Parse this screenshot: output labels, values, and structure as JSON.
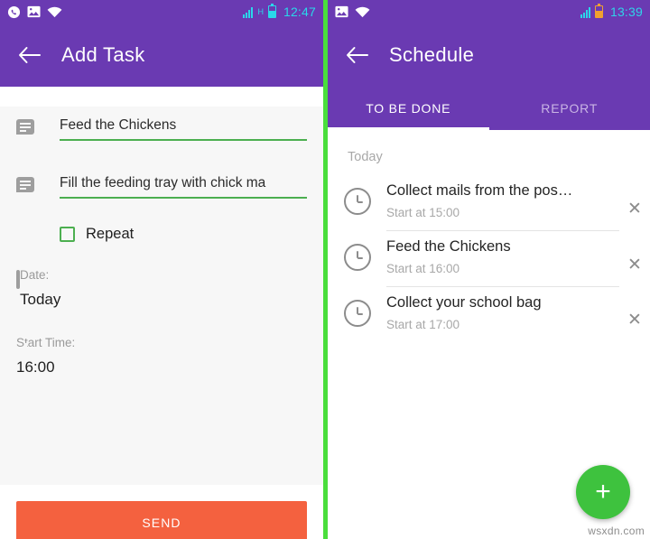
{
  "left": {
    "status": {
      "time": "12:47",
      "icons": [
        "whatsapp-icon",
        "gallery-icon",
        "wifi-icon",
        "signal-icon",
        "battery-icon"
      ]
    },
    "appbar": {
      "title": "Add Task",
      "back_icon": "arrow-back-icon"
    },
    "form": {
      "task_name": "Feed the Chickens",
      "task_description": "Fill the feeding tray with chick ma",
      "repeat_label": "Repeat",
      "repeat_checked": false,
      "date_label": "Date:",
      "date_value": "Today",
      "start_time_label": "Start Time:",
      "start_time_value": "16:00"
    },
    "send_label": "SEND",
    "send_color": "#f4613f"
  },
  "right": {
    "status": {
      "time": "13:39",
      "icons": [
        "gallery-icon",
        "wifi-icon",
        "signal-icon",
        "battery-icon"
      ]
    },
    "appbar": {
      "title": "Schedule",
      "back_icon": "arrow-back-icon"
    },
    "tabs": [
      {
        "label": "TO BE DONE",
        "active": true
      },
      {
        "label": "REPORT",
        "active": false
      }
    ],
    "section": "Today",
    "tasks": [
      {
        "title": "Collect mails from the pos…",
        "sub": "Start at 15:00"
      },
      {
        "title": "Feed the Chickens",
        "sub": "Start at 16:00"
      },
      {
        "title": "Collect your school bag",
        "sub": "Start at 17:00"
      }
    ],
    "fab_label": "+",
    "fab_color": "#3ec23e",
    "watermark": "wsxdn.com"
  },
  "theme": {
    "primary": "#6a3ab2",
    "accent_green": "#4caf50",
    "divider_green": "#4ade3c"
  }
}
